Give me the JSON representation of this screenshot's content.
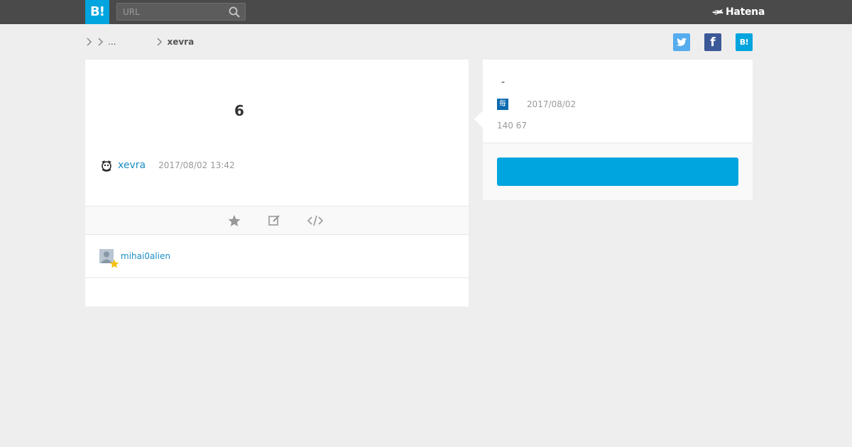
{
  "header": {
    "logo_text": "B!",
    "search_placeholder": "URL",
    "hatena_label": "Hatena"
  },
  "breadcrumb": {
    "ellipsis": "...",
    "user": "xevra"
  },
  "share": {
    "facebook_glyph": "f",
    "hatena_glyph": "B!"
  },
  "entry": {
    "title": "6",
    "author": "xevra",
    "timestamp": "2017/08/02 13:42",
    "star_users": [
      {
        "name": "mihai0alien"
      }
    ]
  },
  "side": {
    "title": "-",
    "source_icon_char": "毎",
    "date": "2017/08/02",
    "counts": "140 67",
    "button_label": ""
  },
  "colors": {
    "brand": "#00a4de",
    "header_bg": "#4a4a4a",
    "link": "#1a8ec2",
    "twitter": "#55acee",
    "facebook": "#3b5998"
  }
}
